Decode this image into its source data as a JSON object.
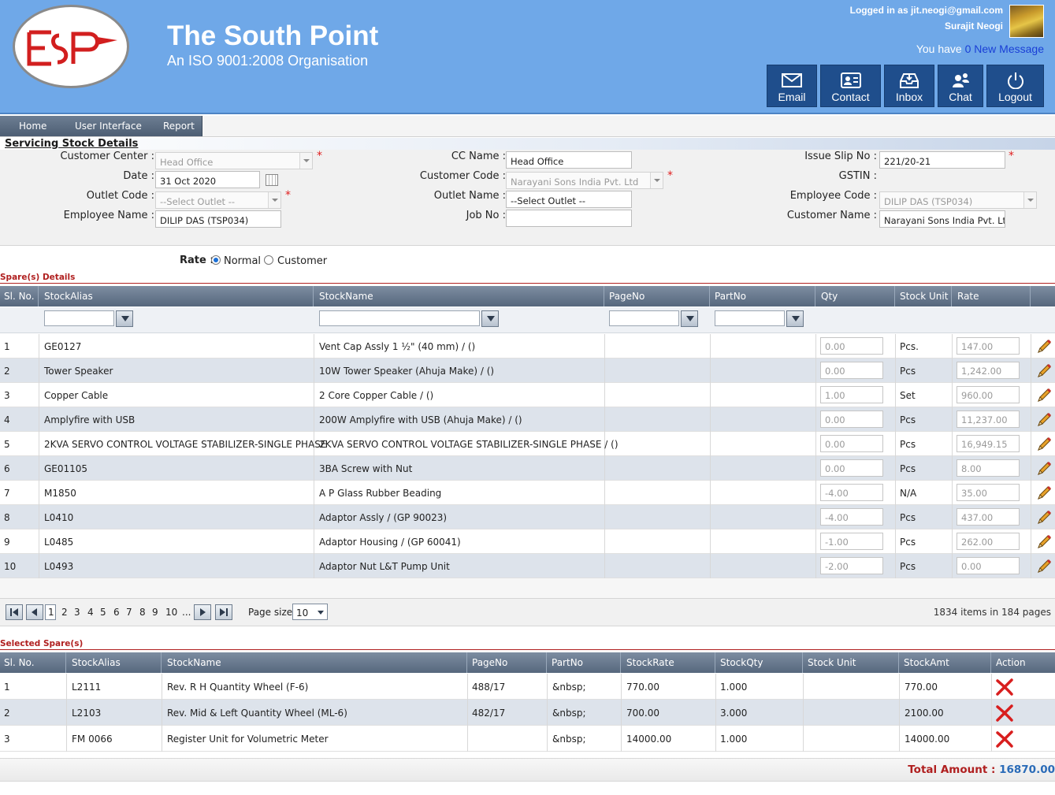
{
  "header": {
    "org_name": "The South Point",
    "org_tagline": "An ISO 9001:2008 Organisation",
    "logged_in_text": "Logged in as jit.neogi@gmail.com",
    "user_name": "Surajit Neogi",
    "message_prefix": "You have ",
    "message_link": "0 New Message",
    "buttons": [
      {
        "label": "Email",
        "icon": "envelope-icon"
      },
      {
        "label": "Contact",
        "icon": "contact-card-icon"
      },
      {
        "label": "Inbox",
        "icon": "inbox-icon"
      },
      {
        "label": "Chat",
        "icon": "chat-people-icon"
      },
      {
        "label": "Logout",
        "icon": "power-icon"
      }
    ]
  },
  "menu": [
    "Home",
    "User Interface",
    "Report"
  ],
  "page_title": "Servicing Stock Details",
  "form": {
    "customer_center_label": "Customer Center :",
    "customer_center_value": "Head Office",
    "date_label": "Date :",
    "date_value": "31 Oct 2020",
    "outlet_code_label": "Outlet Code :",
    "outlet_code_value": "--Select Outlet --",
    "employee_name_label": "Employee Name :",
    "employee_name_value": "DILIP DAS (TSP034)",
    "cc_name_label": "CC Name :",
    "cc_name_value": "Head Office",
    "customer_code_label": "Customer Code :",
    "customer_code_value": "Narayani Sons India Pvt. Ltd",
    "outlet_name_label": "Outlet Name :",
    "outlet_name_value": "--Select Outlet --",
    "job_no_label": "Job No :",
    "job_no_value": "",
    "issue_slip_label": "Issue Slip No :",
    "issue_slip_value": "221/20-21",
    "gstin_label": "GSTIN :",
    "employee_code_label": "Employee Code :",
    "employee_code_value": "DILIP DAS (TSP034)",
    "customer_name_label": "Customer Name :",
    "customer_name_value": "Narayani Sons India Pvt. Ltd",
    "required_mark": "*"
  },
  "rate": {
    "label": "Rate :",
    "options": [
      "Normal",
      "Customer"
    ],
    "selected": "Normal"
  },
  "spares": {
    "heading": "Spare(s) Details",
    "columns": [
      "Sl. No.",
      "StockAlias",
      "StockName",
      "PageNo",
      "PartNo",
      "Qty",
      "Stock Unit",
      "Rate"
    ],
    "rows": [
      {
        "sl": "1",
        "alias": "GE0127",
        "name": "Vent Cap Assly 1 ½\" (40 mm) / ()",
        "qty": "0.00",
        "unit": "Pcs.",
        "rate": "147.00"
      },
      {
        "sl": "2",
        "alias": "Tower Speaker",
        "name": "10W Tower Speaker (Ahuja Make) / ()",
        "qty": "0.00",
        "unit": "Pcs",
        "rate": "1,242.00"
      },
      {
        "sl": "3",
        "alias": "Copper Cable",
        "name": "2 Core Copper Cable / ()",
        "qty": "1.00",
        "unit": "Set",
        "rate": "960.00"
      },
      {
        "sl": "4",
        "alias": "Amplyfire with USB",
        "name": "200W Amplyfire with USB (Ahuja Make) / ()",
        "qty": "0.00",
        "unit": "Pcs",
        "rate": "11,237.00"
      },
      {
        "sl": "5",
        "alias": "2KVA SERVO CONTROL VOLTAGE STABILIZER-SINGLE PHASE",
        "name": "2KVA SERVO CONTROL VOLTAGE STABILIZER-SINGLE PHASE / ()",
        "qty": "0.00",
        "unit": "Pcs",
        "rate": "16,949.15"
      },
      {
        "sl": "6",
        "alias": "GE01105",
        "name": "3BA Screw with Nut",
        "qty": "0.00",
        "unit": "Pcs",
        "rate": "8.00"
      },
      {
        "sl": "7",
        "alias": "M1850",
        "name": "A P Glass Rubber Beading",
        "qty": "-4.00",
        "unit": "N/A",
        "rate": "35.00"
      },
      {
        "sl": "8",
        "alias": "L0410",
        "name": "Adaptor Assly / (GP 90023)",
        "qty": "-4.00",
        "unit": "Pcs",
        "rate": "437.00"
      },
      {
        "sl": "9",
        "alias": "L0485",
        "name": "Adaptor Housing / (GP 60041)",
        "qty": "-1.00",
        "unit": "Pcs",
        "rate": "262.00"
      },
      {
        "sl": "10",
        "alias": "L0493",
        "name": "Adaptor Nut L&T Pump Unit",
        "qty": "-2.00",
        "unit": "Pcs",
        "rate": "0.00"
      }
    ]
  },
  "pager": {
    "current_page": "1",
    "pages": [
      "2",
      "3",
      "4",
      "5",
      "6",
      "7",
      "8",
      "9",
      "10",
      "..."
    ],
    "page_size_label": "Page size:",
    "page_size": "10",
    "summary_count": "1834",
    "summary_mid": " items in ",
    "summary_pages": "184",
    "summary_end": " pages"
  },
  "selected": {
    "heading": "Selected Spare(s)",
    "columns": [
      "Sl. No.",
      "StockAlias",
      "StockName",
      "PageNo",
      "PartNo",
      "StockRate",
      "StockQty",
      "Stock Unit",
      "StockAmt",
      "Action"
    ],
    "rows": [
      {
        "sl": "1",
        "alias": "L2111",
        "name": "Rev. R H Quantity Wheel (F-6)",
        "page": "488/17",
        "part": "&nbsp;",
        "rate": "770.00",
        "qty": "1.000",
        "unit": "",
        "amt": "770.00"
      },
      {
        "sl": "2",
        "alias": "L2103",
        "name": "Rev. Mid & Left Quantity Wheel (ML-6)",
        "page": "482/17",
        "part": "&nbsp;",
        "rate": "700.00",
        "qty": "3.000",
        "unit": "",
        "amt": "2100.00"
      },
      {
        "sl": "3",
        "alias": "FM 0066",
        "name": "Register Unit for Volumetric Meter",
        "page": "",
        "part": "&nbsp;",
        "rate": "14000.00",
        "qty": "1.000",
        "unit": "",
        "amt": "14000.00"
      }
    ]
  },
  "total": {
    "label": "Total Amount : ",
    "value": "16870.00"
  },
  "colors": {
    "header_bg": "#6fa8e8",
    "header_button": "#1f4e8c",
    "required": "#e02020",
    "section_red": "#b02020",
    "total_value": "#2b6cb8"
  }
}
